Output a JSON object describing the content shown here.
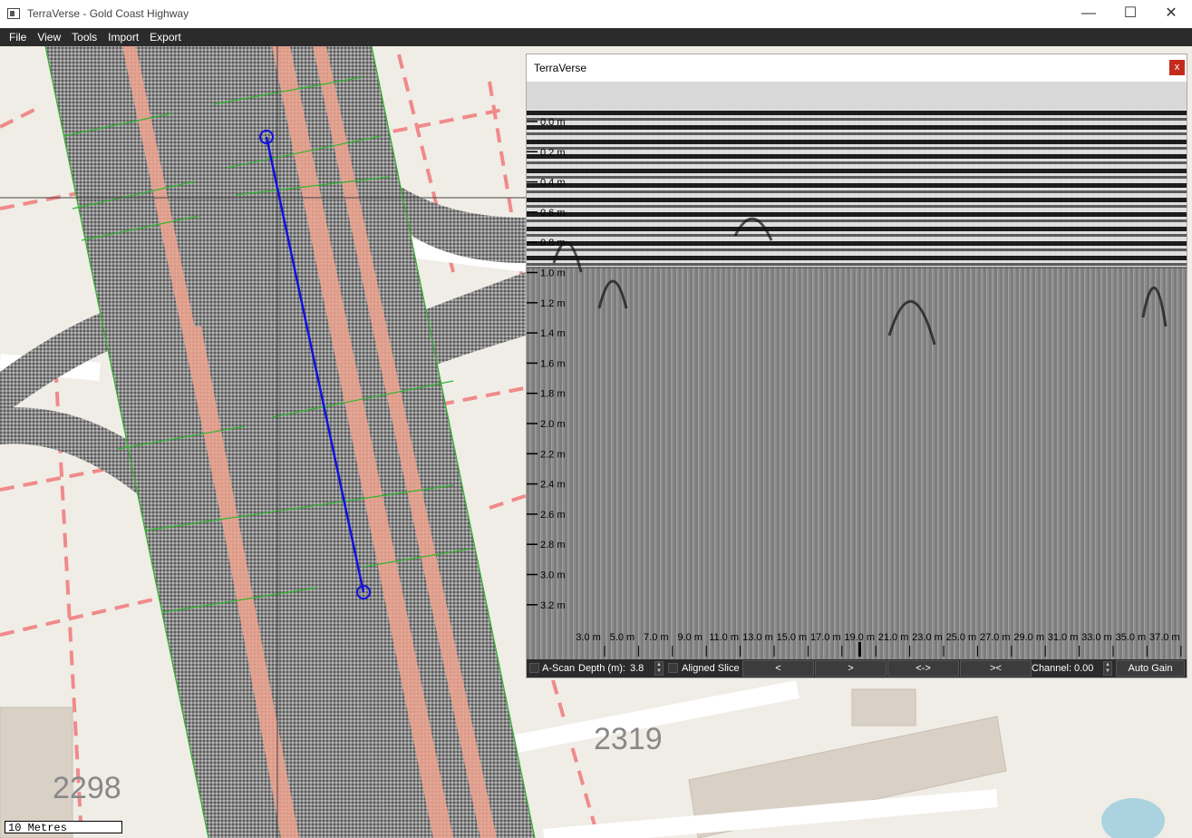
{
  "window": {
    "title": "TerraVerse - Gold Coast Highway"
  },
  "menu": [
    "File",
    "View",
    "Tools",
    "Import",
    "Export"
  ],
  "map": {
    "labels": [
      "2298",
      "2319"
    ],
    "scale_label": "10 Metres"
  },
  "panel": {
    "title": "TerraVerse",
    "close": "x",
    "depth_labels": [
      "0.0 m",
      "0.2 m",
      "0.4 m",
      "0.6 m",
      "0.8 m",
      "1.0 m",
      "1.2 m",
      "1.4 m",
      "1.6 m",
      "1.8 m",
      "2.0 m",
      "2.2 m",
      "2.4 m",
      "2.6 m",
      "2.8 m",
      "3.0 m",
      "3.2 m"
    ],
    "distance_labels": [
      "3.0 m",
      "5.0 m",
      "7.0 m",
      "9.0 m",
      "11.0 m",
      "13.0 m",
      "15.0 m",
      "17.0 m",
      "19.0 m",
      "21.0 m",
      "23.0 m",
      "25.0 m",
      "27.0 m",
      "29.0 m",
      "31.0 m",
      "33.0 m",
      "35.0 m",
      "37.0 m"
    ],
    "controls": {
      "ascan": "A-Scan",
      "depth_label": "Depth (m):",
      "depth_value": "3.8",
      "aligned": "Aligned Slice",
      "prev": "<",
      "next": ">",
      "expand": "<->",
      "contract": "><",
      "channel_label": "Channel:",
      "channel_value": "0.00",
      "auto_gain": "Auto Gain"
    }
  }
}
